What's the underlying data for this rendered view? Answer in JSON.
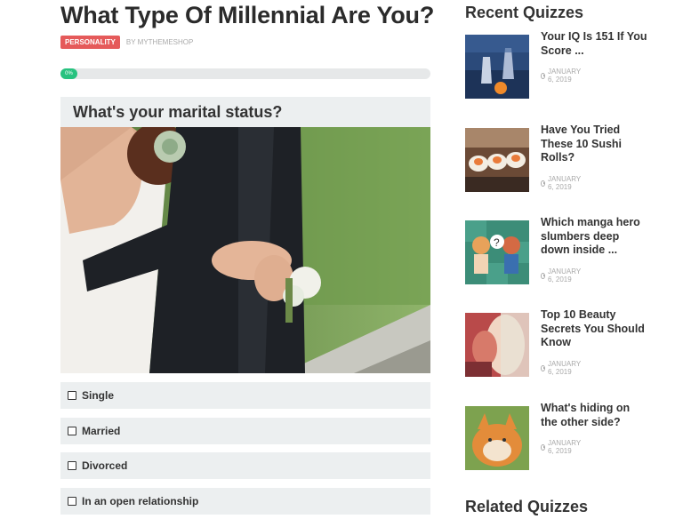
{
  "quiz": {
    "title": "What Type Of Millennial Are You?",
    "category": "PERSONALITY",
    "byline": "BY MYTHEMESHOP",
    "progress_label": "0%",
    "progress_fraction": 0,
    "question": "What's your marital status?",
    "options": [
      "Single",
      "Married",
      "Divorced",
      "In an open relationship"
    ]
  },
  "sidebar": {
    "recent_title": "Recent Quizzes",
    "related_title": "Related Quizzes",
    "recent": [
      {
        "title": "Your IQ Is 151 If You Score ...",
        "date": "JANUARY 6, 2019"
      },
      {
        "title": "Have You Tried These 10 Sushi Rolls?",
        "date": "JANUARY 6, 2019"
      },
      {
        "title": "Which manga hero slumbers deep down inside ...",
        "date": "JANUARY 6, 2019"
      },
      {
        "title": "Top 10 Beauty Secrets You Should Know",
        "date": "JANUARY 6, 2019"
      },
      {
        "title": "What's hiding on the other side?",
        "date": "JANUARY 6, 2019"
      }
    ]
  },
  "colors": {
    "accent_red": "#e55a5a",
    "progress_green": "#27c27f",
    "card_gray": "#eceff0"
  }
}
